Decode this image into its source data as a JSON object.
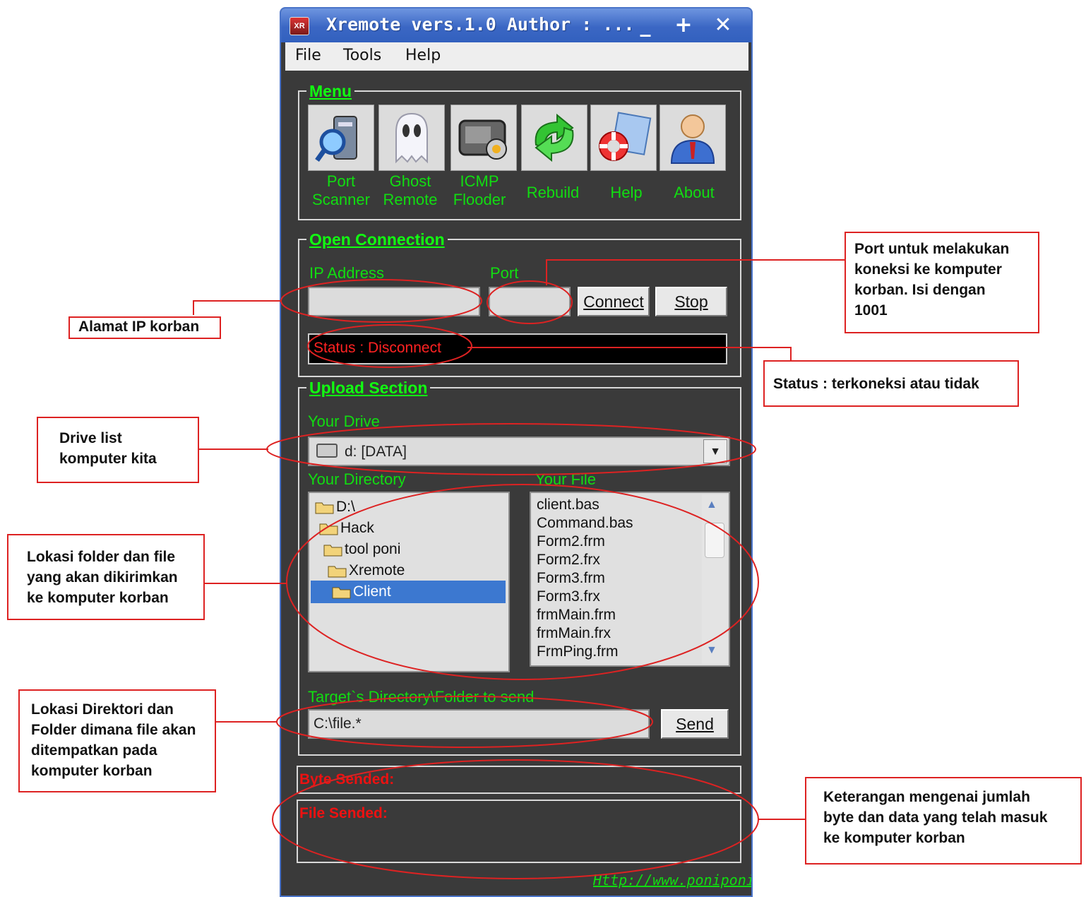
{
  "window": {
    "title": "Xremote vers.1.0 Author : ...",
    "minimize": "_",
    "maximize": "+",
    "close": "✕",
    "app_icon_text": "XR"
  },
  "menubar": [
    "File",
    "Tools",
    "Help"
  ],
  "menu_section": {
    "legend": "Menu",
    "tiles": [
      {
        "line1": "Port",
        "line2": "Scanner",
        "icon": "port-scanner-icon"
      },
      {
        "line1": "Ghost",
        "line2": "Remote",
        "icon": "ghost-icon"
      },
      {
        "line1": "ICMP",
        "line2": "Flooder",
        "icon": "icmp-flooder-icon"
      },
      {
        "line1": "",
        "line2": "Rebuild",
        "icon": "rebuild-arrows-icon"
      },
      {
        "line1": "",
        "line2": "Help",
        "icon": "help-lifebuoy-icon"
      },
      {
        "line1": "",
        "line2": "About",
        "icon": "about-user-icon"
      }
    ]
  },
  "open_connection": {
    "legend": "Open Connection",
    "ip_label": "IP Address",
    "ip_value": "",
    "port_label": "Port",
    "port_value": "",
    "connect_label": "Connect",
    "stop_label": "Stop",
    "status_text": "Status : Disconnect"
  },
  "upload_section": {
    "legend": "Upload Section",
    "drive_label": "Your Drive",
    "drive_value": "d: [DATA]",
    "directory_label": "Your Directory",
    "file_label": "Your File",
    "directories": [
      "D:\\",
      "Hack",
      "tool poni",
      "Xremote",
      "Client"
    ],
    "selected_directory": "Client",
    "files": [
      "client.bas",
      "Command.bas",
      "Form2.frm",
      "Form2.frx",
      "Form3.frm",
      "Form3.frx",
      "frmMain.frm",
      "frmMain.frx",
      "FrmPing.frm"
    ],
    "target_label": "Target`s Directory\\Folder to send",
    "target_value": "C:\\file.*",
    "send_label": "Send"
  },
  "byte_sended_label": "Byte Sended:",
  "file_sended_label": "File Sended:",
  "footer_link": "Http://www.poniponi.tk",
  "annotations": {
    "ip": "Alamat IP korban",
    "port": [
      "Port untuk melakukan",
      "koneksi ke komputer",
      "korban. Isi dengan",
      "1001"
    ],
    "status": "Status : terkoneksi atau tidak",
    "drive": [
      "Drive list",
      "komputer kita"
    ],
    "folder": [
      "Lokasi folder dan file",
      "yang akan dikirimkan",
      "ke komputer korban"
    ],
    "target": [
      "Lokasi Direktori dan",
      "Folder dimana file akan",
      "ditempatkan pada",
      "komputer korban"
    ],
    "bytes": [
      "Keterangan mengenai jumlah",
      "byte dan data yang telah masuk",
      "ke komputer korban"
    ]
  },
  "colors": {
    "accent_green": "#11dd11",
    "status_red": "#ff2222",
    "annotation_red": "#dd2222",
    "title_blue": "#3b67c4"
  }
}
